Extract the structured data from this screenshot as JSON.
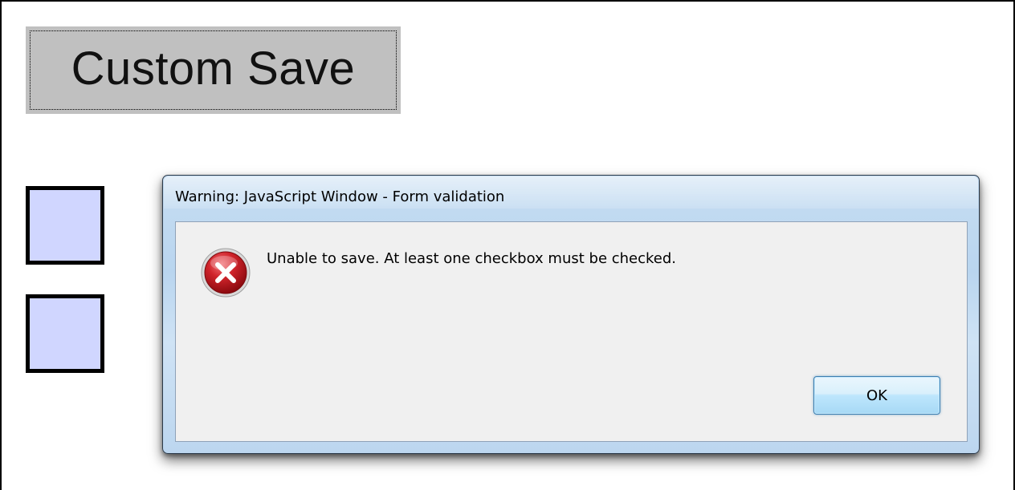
{
  "page": {
    "save_button_label": "Custom Save"
  },
  "checkboxes": [
    {
      "checked": false
    },
    {
      "checked": false
    }
  ],
  "dialog": {
    "title": "Warning: JavaScript Window - Form validation",
    "icon": "error-icon",
    "message": "Unable to save. At least one checkbox must be checked.",
    "ok_label": "OK"
  },
  "colors": {
    "save_button_bg": "#c0c0c0",
    "checkbox_fill": "#d0d6ff",
    "dialog_frame": "#c6ddf2",
    "dialog_client": "#f0f0f0",
    "error_red": "#c8141c"
  }
}
